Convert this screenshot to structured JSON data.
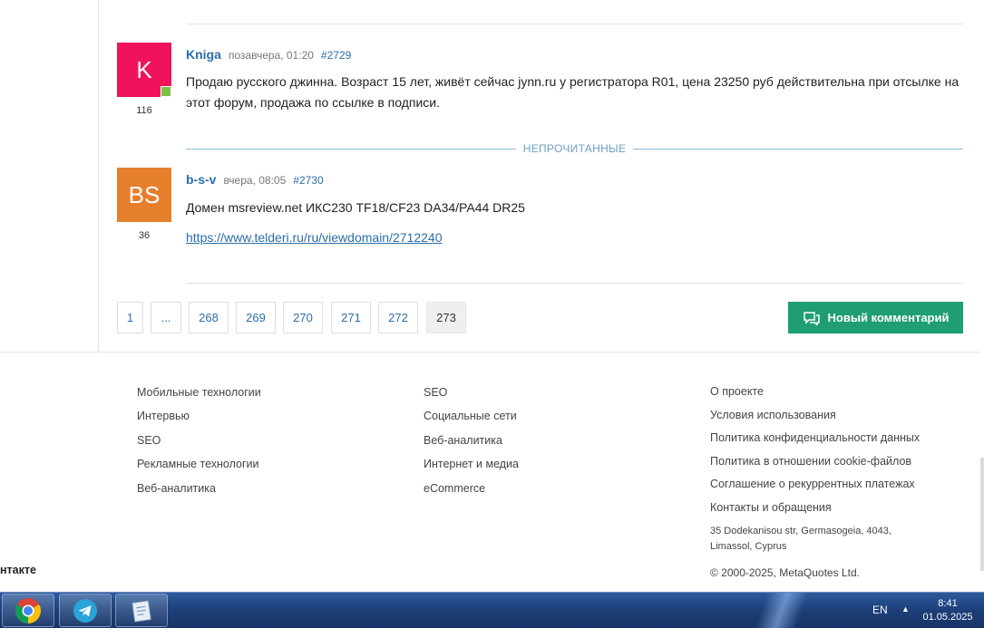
{
  "comments": [
    {
      "avatar_text": "K",
      "avatar_color": "#f0125d",
      "online": true,
      "rating": "116",
      "author": "Kniga",
      "time": "позавчера, 01:20",
      "number": "#2729",
      "text": "Продаю русского джинна. Возраст 15 лет, живёт сейчас  jynn.ru у регистратора R01, цена 23250 руб действительна при отсылке на этот форум, продажа по ссылке в подписи."
    },
    {
      "avatar_text": "BS",
      "avatar_color": "#e67f2c",
      "online": false,
      "rating": "36",
      "author": "b-s-v",
      "time": "вчера, 08:05",
      "number": "#2730",
      "text": "Домен msreview.net ИКС230 TF18/CF23 DA34/PA44 DR25",
      "link": "https://www.telderi.ru/ru/viewdomain/2712240"
    }
  ],
  "unread_label": "НЕПРОЧИТАННЫЕ",
  "pagination": [
    "1",
    "...",
    "268",
    "269",
    "270",
    "271",
    "272",
    "273"
  ],
  "current_page": "273",
  "new_comment_label": "Новый комментарий",
  "footer": {
    "col1": [
      "Мобильные технологии",
      "Интервью",
      "SEO",
      "Рекламные технологии",
      "Веб-аналитика"
    ],
    "col2": [
      "SEO",
      "Социальные сети",
      "Веб-аналитика",
      "Интернет и медиа",
      "eCommerce"
    ],
    "col3": [
      "О проекте",
      "Условия использования",
      "Политика конфиденциальности данных",
      "Политика в отношении cookie-файлов",
      "Соглашение о рекуррентных платежах",
      "Контакты и обращения"
    ],
    "address_line1": "35 Dodekanisou str, Germasogeia, 4043,",
    "address_line2": "Limassol, Cyprus",
    "copyright_prefix": "© 2000-2025, ",
    "copyright_link": "MetaQuotes Ltd.",
    "left_clipped": "нтакте"
  },
  "taskbar": {
    "apps": [
      "chrome-icon",
      "telegram-icon",
      "notepad-icon"
    ],
    "language": "EN",
    "time": "8:41",
    "date": "01.05.2025"
  }
}
